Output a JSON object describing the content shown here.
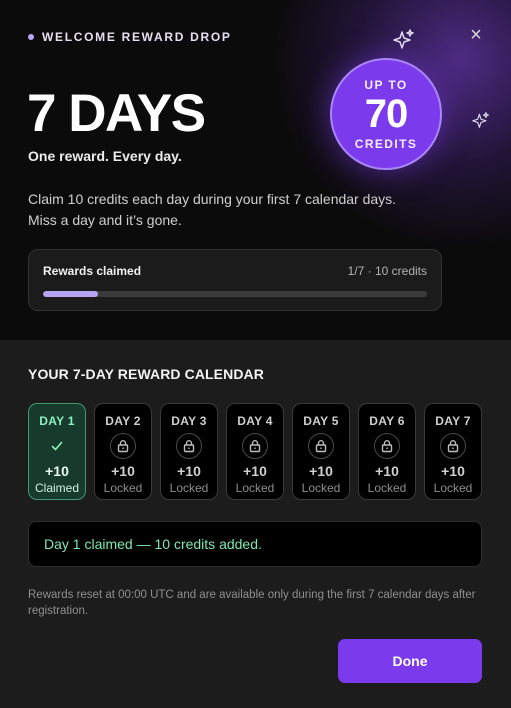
{
  "header": {
    "eyebrow": "WELCOME REWARD DROP",
    "title": "7 DAYS",
    "subtitle": "One reward. Every day.",
    "description": "Claim 10 credits each day during your first 7 calendar days. Miss a day and it’s gone.",
    "close_icon": "close-icon",
    "close_glyph": "×"
  },
  "badge": {
    "top": "UP TO",
    "number": "70",
    "bottom": "CREDITS"
  },
  "progress": {
    "label": "Rewards claimed",
    "value_text": "1/7 · 10 credits",
    "fraction": 0.143
  },
  "calendar": {
    "heading": "YOUR 7-DAY REWARD CALENDAR",
    "days": [
      {
        "label": "DAY 1",
        "credits": "+10",
        "status": "Claimed",
        "icon": "check-icon"
      },
      {
        "label": "DAY 2",
        "credits": "+10",
        "status": "Locked",
        "icon": "lock-icon"
      },
      {
        "label": "DAY 3",
        "credits": "+10",
        "status": "Locked",
        "icon": "lock-icon"
      },
      {
        "label": "DAY 4",
        "credits": "+10",
        "status": "Locked",
        "icon": "lock-icon"
      },
      {
        "label": "DAY 5",
        "credits": "+10",
        "status": "Locked",
        "icon": "lock-icon"
      },
      {
        "label": "DAY 6",
        "credits": "+10",
        "status": "Locked",
        "icon": "lock-icon"
      },
      {
        "label": "DAY 7",
        "credits": "+10",
        "status": "Locked",
        "icon": "lock-icon"
      }
    ]
  },
  "toast": {
    "message": "Day 1 claimed — 10 credits added."
  },
  "footnote": "Rewards reset at 00:00 UTC and are available only during the first 7 calendar days after registration.",
  "actions": {
    "done_label": "Done"
  },
  "colors": {
    "accent": "#7c3aed",
    "success": "#7ee8b4",
    "claimed_bg": "#173a2c",
    "progress_fill": "#b6a4f2"
  }
}
